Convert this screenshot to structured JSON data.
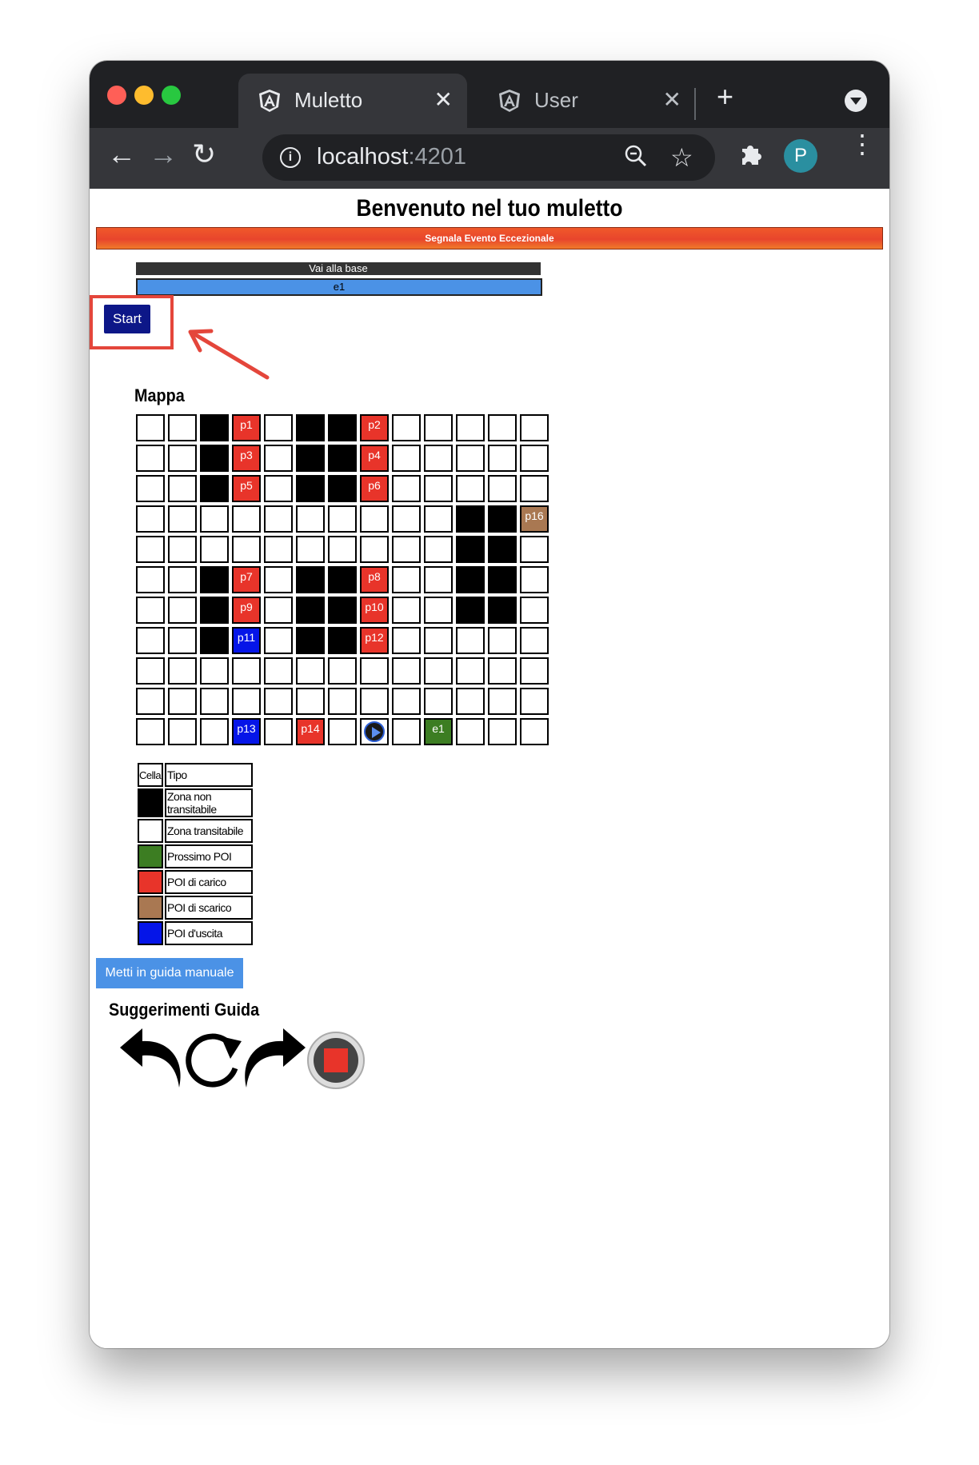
{
  "browser": {
    "tabs": [
      {
        "title": "Muletto",
        "active": true
      },
      {
        "title": "User",
        "active": false
      }
    ],
    "url_host": "localhost",
    "url_port": ":4201",
    "avatar_letter": "P",
    "colors": {
      "titlebar": "#202124",
      "toolbar": "#35363a",
      "dot_red": "#ff5f57",
      "dot_yellow": "#febc2e",
      "dot_green": "#28c840"
    }
  },
  "page": {
    "title": "Benvenuto nel tuo muletto",
    "event_button": "Segnala Evento Eccezionale",
    "base_button": "Vai alla base",
    "destination": "e1",
    "start_button": "Start",
    "map_title": "Mappa",
    "map": {
      "rows": [
        [
          "w",
          "w",
          "b",
          {
            "t": "red",
            "l": "p1"
          },
          "w",
          "b",
          "b",
          {
            "t": "red",
            "l": "p2"
          },
          "w",
          "w",
          "w",
          "w",
          "w"
        ],
        [
          "w",
          "w",
          "b",
          {
            "t": "red",
            "l": "p3"
          },
          "w",
          "b",
          "b",
          {
            "t": "red",
            "l": "p4"
          },
          "w",
          "w",
          "w",
          "w",
          "w"
        ],
        [
          "w",
          "w",
          "b",
          {
            "t": "red",
            "l": "p5"
          },
          "w",
          "b",
          "b",
          {
            "t": "red",
            "l": "p6"
          },
          "w",
          "w",
          "w",
          "w",
          "w"
        ],
        [
          "w",
          "w",
          "w",
          "w",
          "w",
          "w",
          "w",
          "w",
          "w",
          "w",
          "b",
          "b",
          {
            "t": "brown",
            "l": "p16"
          }
        ],
        [
          "w",
          "w",
          "w",
          "w",
          "w",
          "w",
          "w",
          "w",
          "w",
          "w",
          "b",
          "b",
          "w"
        ],
        [
          "w",
          "w",
          "b",
          {
            "t": "red",
            "l": "p7"
          },
          "w",
          "b",
          "b",
          {
            "t": "red",
            "l": "p8"
          },
          "w",
          "w",
          "b",
          "b",
          "w"
        ],
        [
          "w",
          "w",
          "b",
          {
            "t": "red",
            "l": "p9"
          },
          "w",
          "b",
          "b",
          {
            "t": "red",
            "l": "p10"
          },
          "w",
          "w",
          "b",
          "b",
          "w"
        ],
        [
          "w",
          "w",
          "b",
          {
            "t": "blue",
            "l": "p11"
          },
          "w",
          "b",
          "b",
          {
            "t": "red",
            "l": "p12"
          },
          "w",
          "w",
          "w",
          "w",
          "w"
        ],
        [
          "w",
          "w",
          "w",
          "w",
          "w",
          "w",
          "w",
          "w",
          "w",
          "w",
          "w",
          "w",
          "w"
        ],
        [
          "w",
          "w",
          "w",
          "w",
          "w",
          "w",
          "w",
          "w",
          "w",
          "w",
          "w",
          "w",
          "w"
        ],
        [
          "w",
          "w",
          "w",
          {
            "t": "blue",
            "l": "p13"
          },
          "w",
          {
            "t": "red",
            "l": "p14"
          },
          "w",
          {
            "t": "robot",
            "l": ""
          },
          "w",
          {
            "t": "green",
            "l": "e1"
          },
          "w",
          "w",
          "w"
        ]
      ]
    },
    "legend": {
      "header_cell": "Cella",
      "header_type": "Tipo",
      "items": [
        {
          "color": "#000000",
          "label": "Zona non transitabile"
        },
        {
          "color": "#ffffff",
          "label": "Zona transitabile"
        },
        {
          "color": "#3c7d22",
          "label": "Prossimo POI"
        },
        {
          "color": "#e8342a",
          "label": "POI di carico"
        },
        {
          "color": "#a97852",
          "label": "POI di scarico"
        },
        {
          "color": "#0515e8",
          "label": "POI d'uscita"
        }
      ]
    },
    "manual_button": "Metti in guida manuale",
    "guide_title": "Suggerimenti Guida",
    "guide_icons": [
      "turn-left-icon",
      "rotate-icon",
      "turn-right-icon",
      "stop-icon"
    ]
  }
}
